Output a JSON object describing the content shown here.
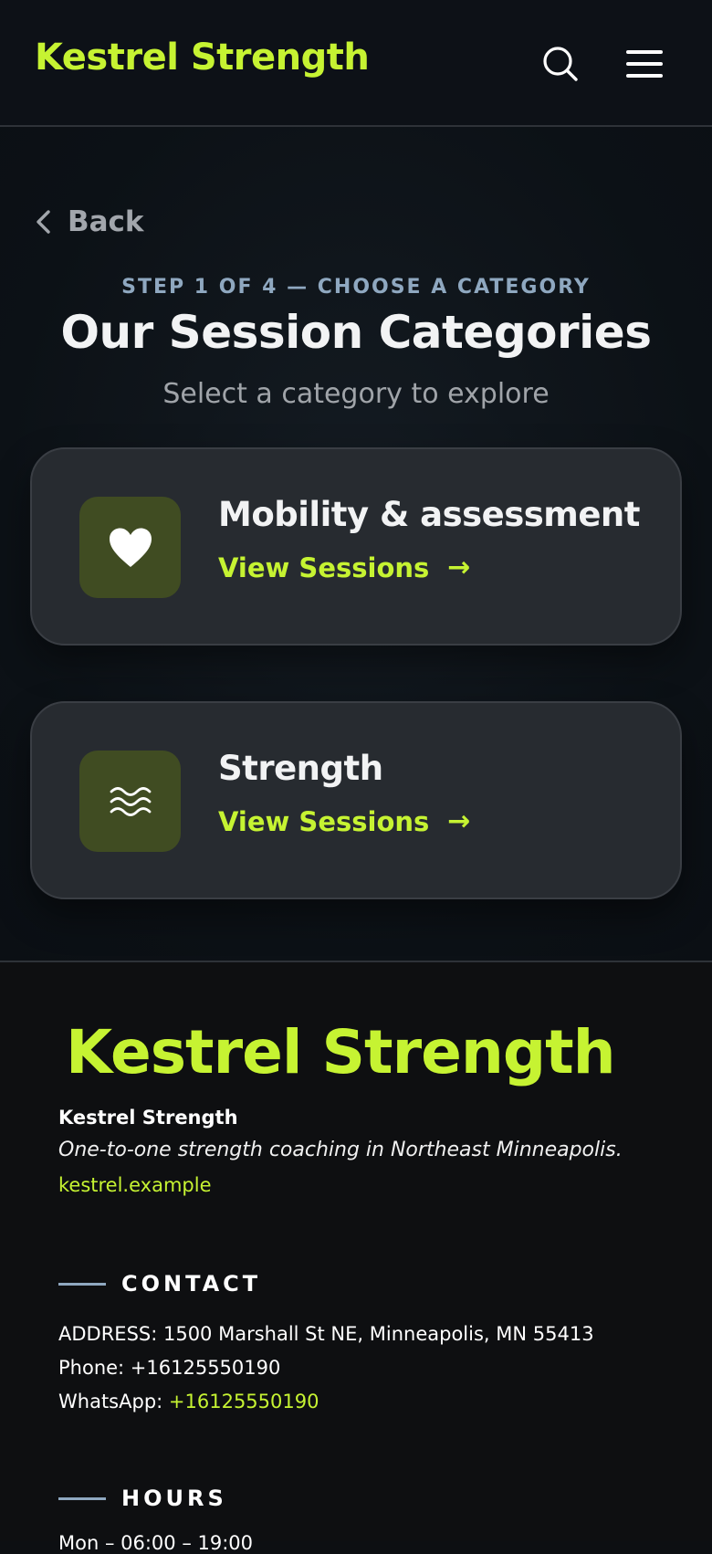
{
  "header": {
    "brand": "Kestrel Strength",
    "search_icon": "search-icon",
    "menu_icon": "hamburger-menu-icon"
  },
  "nav": {
    "back_label": "Back"
  },
  "page": {
    "step_label": "STEP 1 OF 4 — CHOOSE A CATEGORY",
    "title": "Our Session Categories",
    "subtitle": "Select a category to explore"
  },
  "categories": [
    {
      "title": "Mobility & assessment",
      "link_label": "View Sessions",
      "arrow": "→",
      "icon": "heart-icon"
    },
    {
      "title": "Strength",
      "link_label": "View Sessions",
      "arrow": "→",
      "icon": "waves-icon"
    }
  ],
  "footer": {
    "brand": "Kestrel Strength",
    "name": "Kestrel Strength",
    "tagline": "One-to-one strength coaching in Northeast Minneapolis.",
    "website": "kestrel.example",
    "contact": {
      "heading": "CONTACT",
      "address": "ADDRESS: 1500 Marshall St NE, Minneapolis, MN 55413",
      "phone": "Phone: +16125550190",
      "whatsapp_label": "WhatsApp: ",
      "whatsapp_number": "+16125550190"
    },
    "hours": {
      "heading": "HOURS",
      "first_row": "Mon – 06:00 – 19:00"
    }
  },
  "colors": {
    "accent": "#c6f332",
    "muted_blue": "#8fa8c0",
    "card_bg": "#272b30",
    "icon_tile_bg": "#404c22"
  }
}
